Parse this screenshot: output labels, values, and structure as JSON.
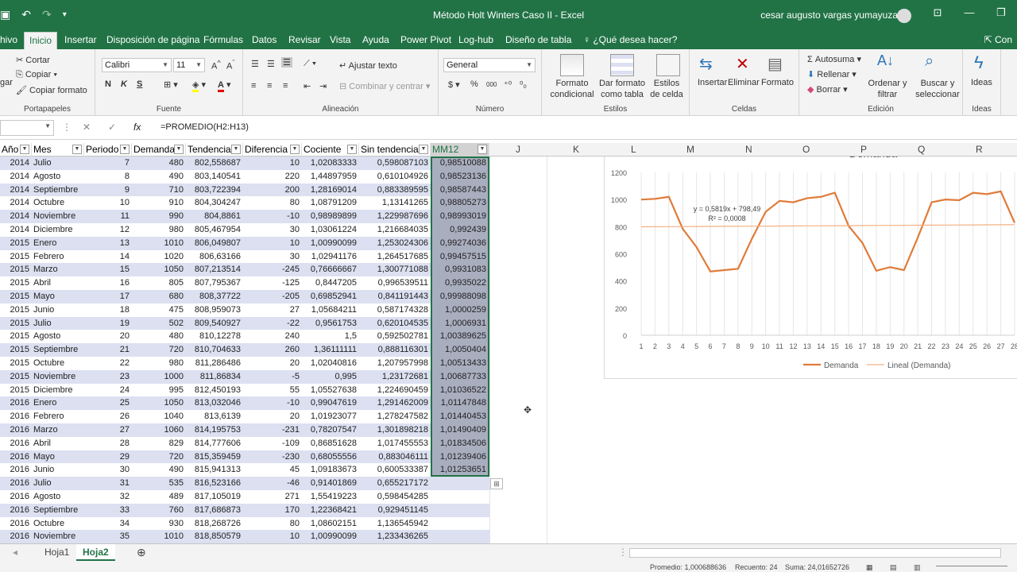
{
  "titlebar": {
    "title": "Método Holt Winters Caso II  -  Excel",
    "user": "cesar augusto vargas yumayuza",
    "undo_icon": "undo-icon",
    "redo_icon": "redo-icon",
    "save_icon": "save-icon"
  },
  "tabs": [
    "hivo",
    "Inicio",
    "Insertar",
    "Disposición de página",
    "Fórmulas",
    "Datos",
    "Revisar",
    "Vista",
    "Ayuda",
    "Power Pivot",
    "Log-hub",
    "Diseño de tabla",
    "¿Qué desea hacer?"
  ],
  "share_label": "Con",
  "ribbon": {
    "clipboard": {
      "paste": "gar",
      "cut": "Cortar",
      "copy": "Copiar",
      "format_painter": "Copiar formato",
      "label": "Portapapeles"
    },
    "font": {
      "name": "Calibri",
      "size": "11",
      "bold": "N",
      "italic": "K",
      "underline": "S",
      "label": "Fuente"
    },
    "alignment": {
      "wrap": "Ajustar texto",
      "merge": "Combinar y centrar",
      "label": "Alineación"
    },
    "number": {
      "format": "General",
      "currency": "$",
      "percent": "%",
      "thousands": "000",
      "label": "Número"
    },
    "styles": {
      "conditional": "Formato condicional",
      "as_table": "Dar formato como tabla",
      "cell_styles": "Estilos de celda",
      "label": "Estilos"
    },
    "cells": {
      "insert": "Insertar",
      "delete": "Eliminar",
      "format": "Formato",
      "label": "Celdas"
    },
    "editing": {
      "autosum": "Autosuma",
      "fill": "Rellenar",
      "clear": "Borrar",
      "sort": "Ordenar y filtrar",
      "find": "Buscar y seleccionar",
      "label": "Edición"
    },
    "ideas": {
      "ideas": "Ideas",
      "label": "Ideas"
    }
  },
  "formula_bar": {
    "fx": "fx",
    "formula": "=PROMEDIO(H2:H13)"
  },
  "columns": [
    "J",
    "K",
    "L",
    "M",
    "N",
    "O",
    "P",
    "Q",
    "R"
  ],
  "table_headers": [
    "Año",
    "Mes",
    "Periodo",
    "Demanda",
    "Tendencia",
    "Diferencia",
    "Cociente",
    "Sin tendencia",
    "MM12"
  ],
  "rows": [
    [
      "2014",
      "Julio",
      "7",
      "480",
      "802,558687",
      "10",
      "1,02083333",
      "0,598087103",
      "0,98510088"
    ],
    [
      "2014",
      "Agosto",
      "8",
      "490",
      "803,140541",
      "220",
      "1,44897959",
      "0,610104926",
      "0,98523136"
    ],
    [
      "2014",
      "Septiembre",
      "9",
      "710",
      "803,722394",
      "200",
      "1,28169014",
      "0,883389595",
      "0,98587443"
    ],
    [
      "2014",
      "Octubre",
      "10",
      "910",
      "804,304247",
      "80",
      "1,08791209",
      "1,13141265",
      "0,98805273"
    ],
    [
      "2014",
      "Noviembre",
      "11",
      "990",
      "804,8861",
      "-10",
      "0,98989899",
      "1,229987696",
      "0,98993019"
    ],
    [
      "2014",
      "Diciembre",
      "12",
      "980",
      "805,467954",
      "30",
      "1,03061224",
      "1,216684035",
      "0,992439"
    ],
    [
      "2015",
      "Enero",
      "13",
      "1010",
      "806,049807",
      "10",
      "1,00990099",
      "1,253024306",
      "0,99274036"
    ],
    [
      "2015",
      "Febrero",
      "14",
      "1020",
      "806,63166",
      "30",
      "1,02941176",
      "1,264517685",
      "0,99457515"
    ],
    [
      "2015",
      "Marzo",
      "15",
      "1050",
      "807,213514",
      "-245",
      "0,76666667",
      "1,300771088",
      "0,9931083"
    ],
    [
      "2015",
      "Abril",
      "16",
      "805",
      "807,795367",
      "-125",
      "0,8447205",
      "0,996539511",
      "0,9935022"
    ],
    [
      "2015",
      "Mayo",
      "17",
      "680",
      "808,37722",
      "-205",
      "0,69852941",
      "0,841191443",
      "0,99988098"
    ],
    [
      "2015",
      "Junio",
      "18",
      "475",
      "808,959073",
      "27",
      "1,05684211",
      "0,587174328",
      "1,0000259"
    ],
    [
      "2015",
      "Julio",
      "19",
      "502",
      "809,540927",
      "-22",
      "0,9561753",
      "0,620104535",
      "1,0006931"
    ],
    [
      "2015",
      "Agosto",
      "20",
      "480",
      "810,12278",
      "240",
      "1,5",
      "0,592502781",
      "1,00389625"
    ],
    [
      "2015",
      "Septiembre",
      "21",
      "720",
      "810,704633",
      "260",
      "1,36111111",
      "0,888116301",
      "1,0050404"
    ],
    [
      "2015",
      "Octubre",
      "22",
      "980",
      "811,286486",
      "20",
      "1,02040816",
      "1,207957998",
      "1,00513433"
    ],
    [
      "2015",
      "Noviembre",
      "23",
      "1000",
      "811,86834",
      "-5",
      "0,995",
      "1,23172681",
      "1,00687733"
    ],
    [
      "2015",
      "Diciembre",
      "24",
      "995",
      "812,450193",
      "55",
      "1,05527638",
      "1,224690459",
      "1,01036522"
    ],
    [
      "2016",
      "Enero",
      "25",
      "1050",
      "813,032046",
      "-10",
      "0,99047619",
      "1,291462009",
      "1,01147848"
    ],
    [
      "2016",
      "Febrero",
      "26",
      "1040",
      "813,6139",
      "20",
      "1,01923077",
      "1,278247582",
      "1,01440453"
    ],
    [
      "2016",
      "Marzo",
      "27",
      "1060",
      "814,195753",
      "-231",
      "0,78207547",
      "1,301898218",
      "1,01490409"
    ],
    [
      "2016",
      "Abril",
      "28",
      "829",
      "814,777606",
      "-109",
      "0,86851628",
      "1,017455553",
      "1,01834506"
    ],
    [
      "2016",
      "Mayo",
      "29",
      "720",
      "815,359459",
      "-230",
      "0,68055556",
      "0,883046111",
      "1,01239406"
    ],
    [
      "2016",
      "Junio",
      "30",
      "490",
      "815,941313",
      "45",
      "1,09183673",
      "0,600533387",
      "1,01253651"
    ],
    [
      "2016",
      "Julio",
      "31",
      "535",
      "816,523166",
      "-46",
      "0,91401869",
      "0,655217172",
      ""
    ],
    [
      "2016",
      "Agosto",
      "32",
      "489",
      "817,105019",
      "271",
      "1,55419223",
      "0,598454285",
      ""
    ],
    [
      "2016",
      "Septiembre",
      "33",
      "760",
      "817,686873",
      "170",
      "1,22368421",
      "0,929451145",
      ""
    ],
    [
      "2016",
      "Octubre",
      "34",
      "930",
      "818,268726",
      "80",
      "1,08602151",
      "1,136545942",
      ""
    ],
    [
      "2016",
      "Noviembre",
      "35",
      "1010",
      "818,850579",
      "10",
      "1,00990099",
      "1,233436265",
      ""
    ]
  ],
  "chart_data": {
    "type": "line",
    "title": "Demanda",
    "x": [
      1,
      2,
      3,
      4,
      5,
      6,
      7,
      8,
      9,
      10,
      11,
      12,
      13,
      14,
      15,
      16,
      17,
      18,
      19,
      20,
      21,
      22,
      23,
      24,
      25,
      26,
      27,
      28
    ],
    "series": [
      {
        "name": "Demanda",
        "values": [
          1000,
          1005,
          1020,
          785,
          650,
          470,
          480,
          490,
          710,
          910,
          990,
          980,
          1010,
          1020,
          1050,
          805,
          680,
          475,
          502,
          480,
          720,
          980,
          1000,
          995,
          1050,
          1040,
          1060,
          829
        ]
      },
      {
        "name": "Lineal (Demanda)",
        "values": [
          799.07,
          799.65,
          800.23,
          800.82,
          801.4,
          801.98,
          802.56,
          803.14,
          803.72,
          804.3,
          804.89,
          805.47,
          806.05,
          806.63,
          807.21,
          807.8,
          808.38,
          808.96,
          809.54,
          810.12,
          810.7,
          811.29,
          811.87,
          812.45,
          813.03,
          813.61,
          814.2,
          814.78
        ]
      }
    ],
    "ylim": [
      0,
      1200
    ],
    "yticks": [
      "0",
      "200",
      "400",
      "600",
      "800",
      "1000",
      "1200"
    ],
    "trend_equation": "y = 0,5819x + 798,49",
    "trend_r2": "R² = 0,0008",
    "legend": "bottom",
    "colors": {
      "demanda": "#e07b39",
      "lineal": "#f4b183"
    }
  },
  "sheets": [
    "Hoja1",
    "Hoja2"
  ],
  "status": {
    "avg": "Promedio: 1,000688636",
    "count": "Recuento: 24",
    "sum": "Suma: 24,01652726"
  }
}
